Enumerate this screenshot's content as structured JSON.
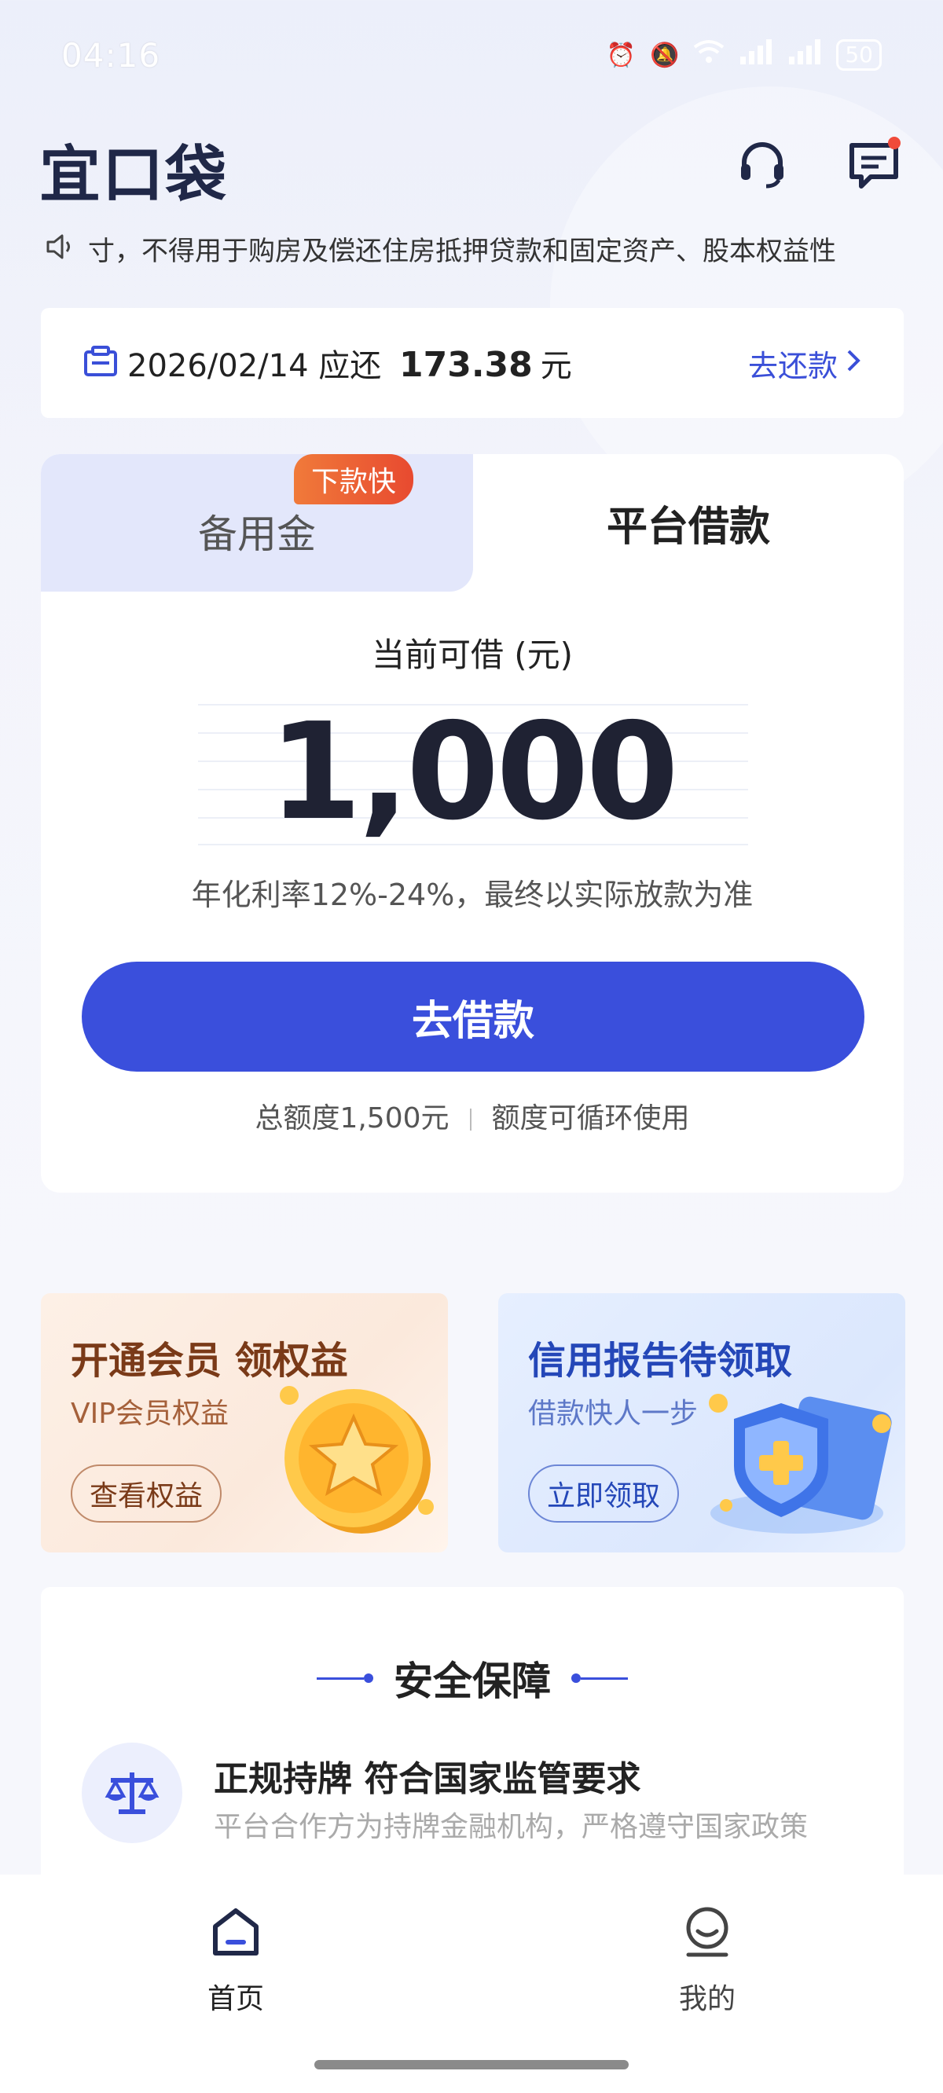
{
  "status_bar": {
    "time": "04:16",
    "battery": "50",
    "network_1": "4G",
    "network_2": "4G"
  },
  "header": {
    "logo": "宜口袋",
    "icons": [
      "headset-icon",
      "message-icon"
    ]
  },
  "notice": {
    "text": "寸，不得用于购房及偿还住房抵押贷款和固定资产、股本权益性"
  },
  "repayment": {
    "date": "2026/02/14",
    "due_label": "应还",
    "amount": "173.38",
    "unit": "元",
    "link": "去还款"
  },
  "loan_tabs": {
    "left": "备用金",
    "left_badge": "下款快",
    "right": "平台借款"
  },
  "loan": {
    "label": "当前可借 (元)",
    "amount": "1,000",
    "rate": "年化利率12%-24%，最终以实际放款为准",
    "button": "去借款",
    "total_quota": "总额度1,500元",
    "recycle": "额度可循环使用"
  },
  "promos": {
    "vip": {
      "title": "开通会员 领权益",
      "subtitle": "VIP会员权益",
      "button": "查看权益"
    },
    "credit": {
      "title": "信用报告待领取",
      "subtitle": "借款快人一步",
      "button": "立即领取"
    }
  },
  "security": {
    "title": "安全保障",
    "item_title": "正规持牌 符合国家监管要求",
    "item_desc": "平台合作方为持牌金融机构，严格遵守国家政策"
  },
  "nav": {
    "home": "首页",
    "mine": "我的"
  },
  "colors": {
    "accent": "#3a4fdc",
    "badge": "#e84a30",
    "background": "#eceffa"
  }
}
